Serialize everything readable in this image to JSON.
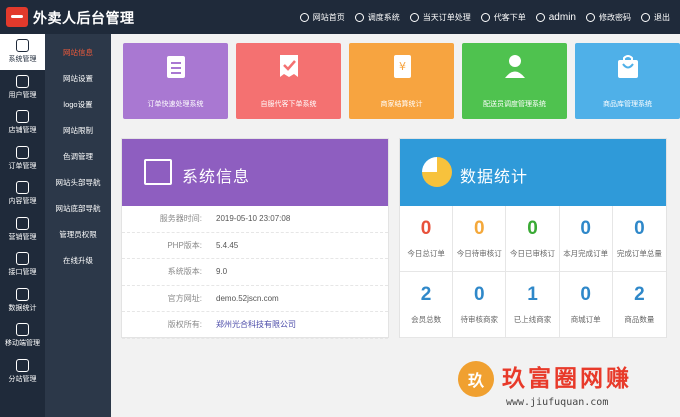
{
  "app": {
    "title": "外卖人后台管理"
  },
  "topnav": {
    "items": [
      "网站首页",
      "调度系统",
      "当天订单处理",
      "代客下单"
    ],
    "user": "admin",
    "change_password": "修改密码",
    "logout": "退出"
  },
  "sidebar": {
    "items": [
      "系统管理",
      "用户管理",
      "店铺管理",
      "订单管理",
      "内容管理",
      "营销管理",
      "接口管理",
      "数据统计",
      "移动端管理",
      "分站管理"
    ],
    "active": "系统管理"
  },
  "subnav": {
    "items": [
      "网站信息",
      "网站设置",
      "logo设置",
      "网站限制",
      "色调管理",
      "网站头部导航",
      "网站底部导航",
      "管理员权限",
      "在线升级"
    ],
    "active": "网站信息"
  },
  "tiles": [
    {
      "label": "订单快速处理系统",
      "color": "#a978d2"
    },
    {
      "label": "自服代客下单系统",
      "color": "#f47171"
    },
    {
      "label": "商家结算统计",
      "color": "#f7a440"
    },
    {
      "label": "配送员调度管理系统",
      "color": "#4fc24f"
    },
    {
      "label": "商品库管理系统",
      "color": "#4fb0e8"
    }
  ],
  "system_info": {
    "title": "系统信息",
    "rows": [
      {
        "key": "服务器时间:",
        "value": "2019-05-10 23:07:08"
      },
      {
        "key": "PHP版本:",
        "value": "5.4.45"
      },
      {
        "key": "系统版本:",
        "value": "9.0"
      },
      {
        "key": "官方网址:",
        "value": "demo.52jscn.com"
      },
      {
        "key": "版权所有:",
        "value": "郑州光合科技有限公司"
      }
    ]
  },
  "stats": {
    "title": "数据统计",
    "cells": [
      {
        "value": "0",
        "label": "今日总订单",
        "color": "#e8513b"
      },
      {
        "value": "0",
        "label": "今日待审核订",
        "color": "#f4a83a"
      },
      {
        "value": "0",
        "label": "今日已审核订",
        "color": "#3aaa35"
      },
      {
        "value": "0",
        "label": "本月完成订单",
        "color": "#2f88c9"
      },
      {
        "value": "0",
        "label": "完成订单总量",
        "color": "#2f88c9"
      },
      {
        "value": "2",
        "label": "会员总数",
        "color": "#2f88c9"
      },
      {
        "value": "0",
        "label": "待审核商家",
        "color": "#2f88c9"
      },
      {
        "value": "1",
        "label": "已上线商家",
        "color": "#2f88c9"
      },
      {
        "value": "0",
        "label": "商城订单",
        "color": "#2f88c9"
      },
      {
        "value": "2",
        "label": "商品数量",
        "color": "#2f88c9"
      }
    ]
  },
  "watermark": {
    "badge": "玖",
    "text": "玖富圈网赚",
    "url": "www.jiufuquan.com"
  }
}
